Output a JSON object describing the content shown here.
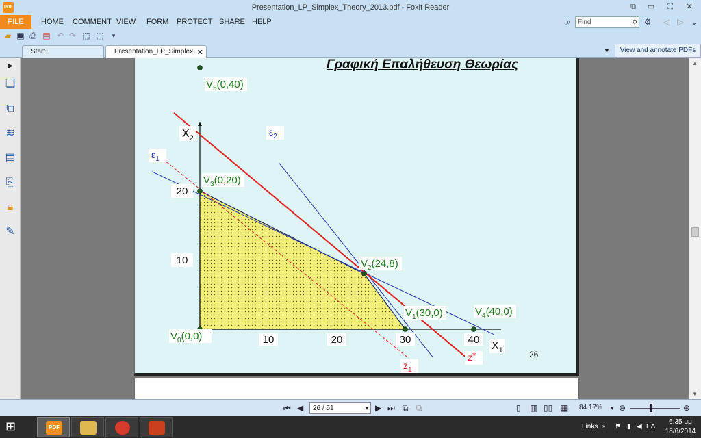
{
  "window": {
    "title": "Presentation_LP_Simplex_Theory_2013.pdf - Foxit Reader",
    "app_icon_label": "PDF"
  },
  "menu": {
    "file": "FILE",
    "items": [
      "HOME",
      "COMMENT",
      "VIEW",
      "FORM",
      "PROTECT",
      "SHARE",
      "HELP"
    ],
    "find_placeholder": "Find"
  },
  "tabs": {
    "start": "Start",
    "doc": "Presentation_LP_Simplex...",
    "view_annotate": "View and annotate PDFs"
  },
  "slide": {
    "title": "Γραφική Επαλήθευση Θεωρίας",
    "page_number": "26"
  },
  "chart_data": {
    "type": "line",
    "xlabel": "X1",
    "ylabel": "X2",
    "x_ticks": [
      "10",
      "20",
      "30",
      "40"
    ],
    "y_ticks": [
      "10",
      "20"
    ],
    "feasible_region": [
      [
        0,
        0
      ],
      [
        0,
        20
      ],
      [
        24,
        8
      ],
      [
        30,
        0
      ]
    ],
    "points": [
      {
        "name": "V0",
        "coords": "(0,0)",
        "x": 0,
        "y": 0
      },
      {
        "name": "V1",
        "coords": "(30,0)",
        "x": 30,
        "y": 0
      },
      {
        "name": "V2",
        "coords": "(24,8)",
        "x": 24,
        "y": 8
      },
      {
        "name": "V3",
        "coords": "(0,20)",
        "x": 0,
        "y": 20
      },
      {
        "name": "V4",
        "coords": "(40,0)",
        "x": 40,
        "y": 0
      },
      {
        "name": "V5",
        "coords": "(0,40)",
        "x": 0,
        "y": 40
      }
    ],
    "lines": [
      {
        "name": "ε1",
        "color": "#2233aa",
        "style": "solid"
      },
      {
        "name": "ε2",
        "color": "#2233aa",
        "style": "solid"
      },
      {
        "name": "z*",
        "color": "#e02020",
        "style": "solid"
      },
      {
        "name": "z1",
        "color": "#e02020",
        "style": "dashed"
      }
    ]
  },
  "status": {
    "page_field": "26 / 51",
    "zoom": "84.17%"
  },
  "taskbar": {
    "links": "Links",
    "lang": "ΕΛ",
    "time": "6:35 μμ",
    "date": "18/6/2014"
  }
}
